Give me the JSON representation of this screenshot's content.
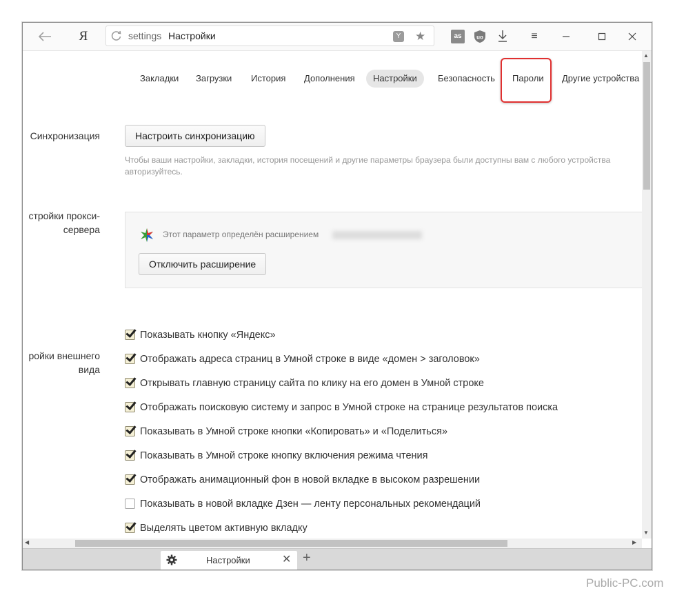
{
  "toolbar": {
    "yandex_logo": "Я",
    "url_proto": "settings",
    "url_title": "Настройки",
    "lastfm_ext": "as",
    "menu_icon": "≡"
  },
  "nav": {
    "tabs": [
      {
        "label": "Закладки",
        "active": false
      },
      {
        "label": "Загрузки",
        "active": false
      },
      {
        "label": "История",
        "active": false
      },
      {
        "label": "Дополнения",
        "active": false
      },
      {
        "label": "Настройки",
        "active": true
      },
      {
        "label": "Безопасность",
        "active": false
      },
      {
        "label": "Пароли",
        "active": false,
        "highlighted": true
      },
      {
        "label": "Другие устройства",
        "active": false
      }
    ]
  },
  "sync": {
    "label": "Синхронизация",
    "button": "Настроить синхронизацию",
    "hint_line1": "Чтобы ваши настройки, закладки, история посещений и другие параметры браузера были доступны вам с любого устройства",
    "hint_line2": "авторизуйтесь."
  },
  "proxy": {
    "label_line1": "стройки прокси-",
    "label_line2": "сервера",
    "ext_text": "Этот параметр определён расширением",
    "button": "Отключить расширение"
  },
  "appearance": {
    "label_line1": "ройки внешнего",
    "label_line2": "вида",
    "options": [
      {
        "label": "Показывать кнопку «Яндекс»",
        "checked": true
      },
      {
        "label": "Отображать адреса страниц в Умной строке в виде «домен > заголовок»",
        "checked": true
      },
      {
        "label": "Открывать главную страницу сайта по клику на его домен в Умной строке",
        "checked": true
      },
      {
        "label": "Отображать поисковую систему и запрос в Умной строке на странице результатов поиска",
        "checked": true
      },
      {
        "label": "Показывать в Умной строке кнопки «Копировать» и «Поделиться»",
        "checked": true
      },
      {
        "label": "Показывать в Умной строке кнопку включения режима чтения",
        "checked": true
      },
      {
        "label": "Отображать анимационный фон в новой вкладке в высоком разрешении",
        "checked": true
      },
      {
        "label": "Показывать в новой вкладке Дзен — ленту персональных рекомендаций",
        "checked": false
      },
      {
        "label": "Выделять цветом активную вкладку",
        "checked": true
      }
    ]
  },
  "tabstrip": {
    "tab_title": "Настройки",
    "close": "✕",
    "new_tab": "+"
  },
  "watermark": "Public-PC.com",
  "colors": {
    "highlight": "#e03030",
    "active_tab_bg": "#e6e6e6"
  }
}
